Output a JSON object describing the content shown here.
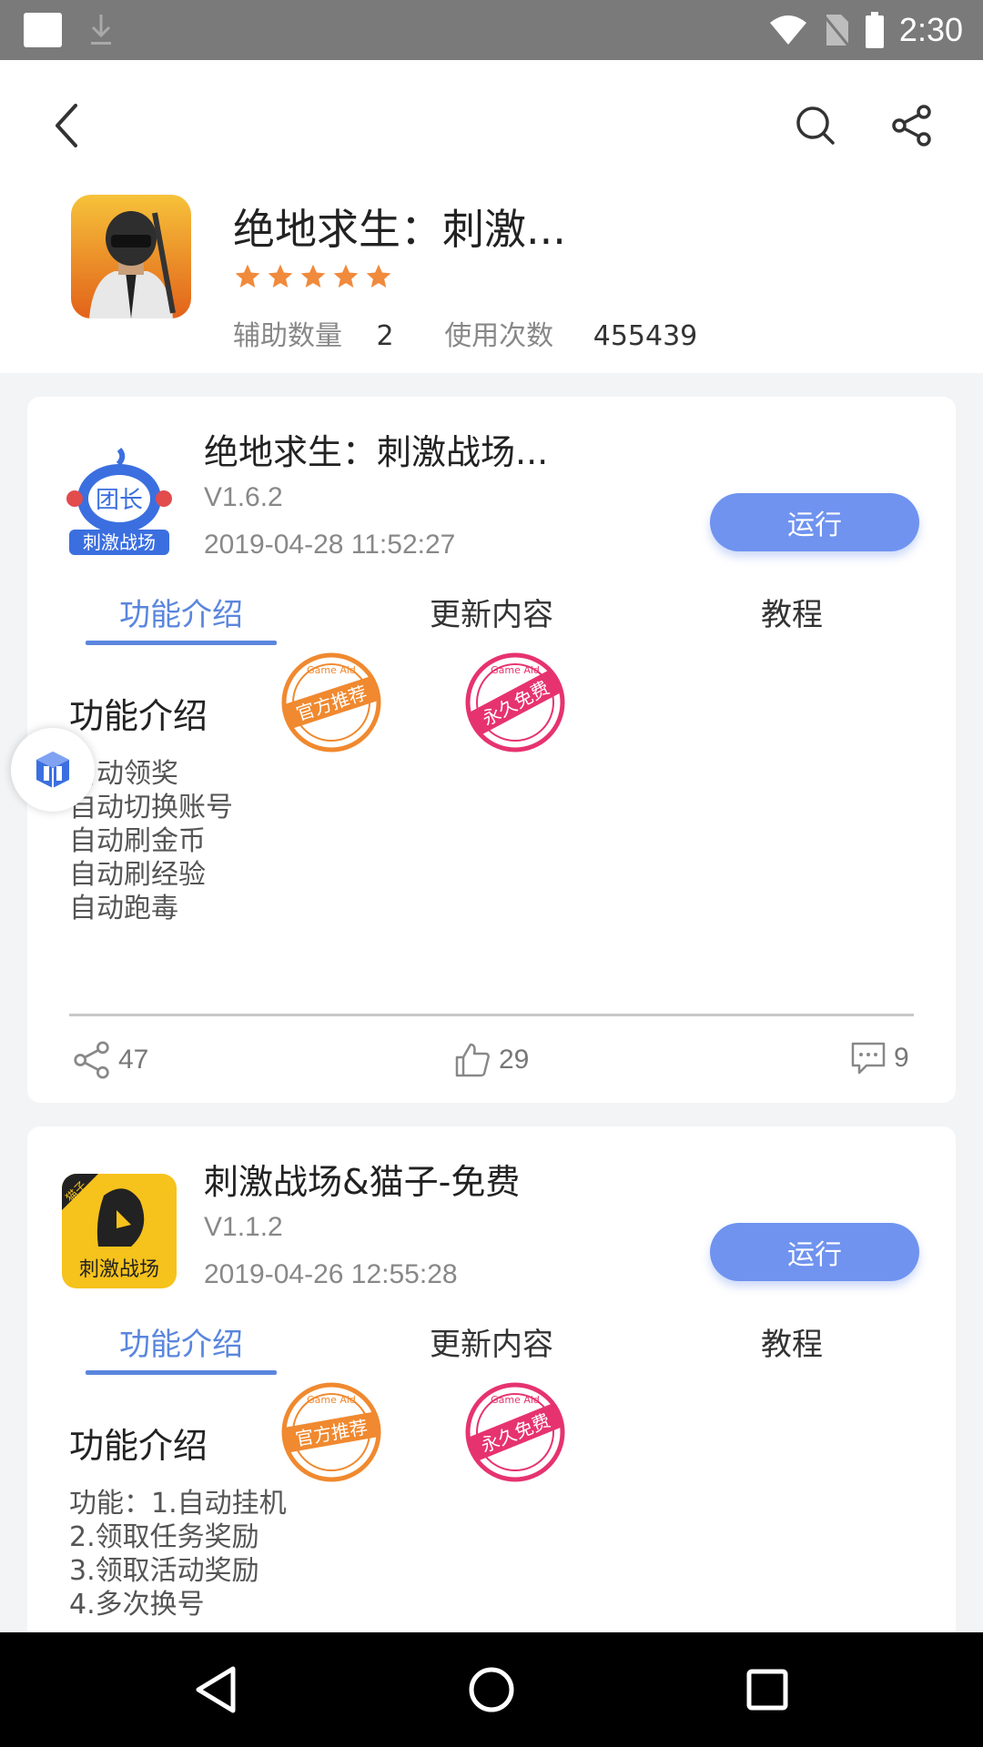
{
  "status_bar": {
    "time": "2:30"
  },
  "header": {
    "title": "绝地求生：刺激...",
    "rating_stars": 5,
    "assist_label": "辅助数量",
    "assist_count": "2",
    "usage_label": "使用次数",
    "usage_count": "455439"
  },
  "cards": [
    {
      "name": "绝地求生：刺激战场...",
      "version": "V1.6.2",
      "date": "2019-04-28 11:52:27",
      "run_label": "运行",
      "icon_text_top": "团长",
      "icon_text_bottom": "刺激战场",
      "tabs": [
        "功能介绍",
        "更新内容",
        "教程"
      ],
      "section_title": "功能介绍",
      "stamp_official": "官方推荐",
      "stamp_free": "永久免费",
      "stamp_ring": "Game Aid",
      "features": [
        "自动领奖",
        "自动切换账号",
        "自动刷金币",
        "自动刷经验",
        "自动跑毒"
      ],
      "shares": "47",
      "likes": "29",
      "comments": "9"
    },
    {
      "name": "刺激战场&猫子-免费",
      "version": "V1.1.2",
      "date": "2019-04-26 12:55:28",
      "run_label": "运行",
      "icon_text_top": "猫子",
      "icon_text_bottom": "刺激战场",
      "tabs": [
        "功能介绍",
        "更新内容",
        "教程"
      ],
      "section_title": "功能介绍",
      "stamp_official": "官方推荐",
      "stamp_free": "永久免费",
      "stamp_ring": "Game Aid",
      "features": [
        "功能：1.自动挂机",
        "2.领取任务奖励",
        "3.领取活动奖励",
        "4.多次换号"
      ]
    }
  ],
  "colors": {
    "accent": "#5a86dd",
    "run_button": "#6f93ef",
    "star": "#f08a3c",
    "stamp_orange": "#f0892f",
    "stamp_pink": "#e6336f"
  },
  "icons": {
    "back": "chevron-left-icon",
    "search": "search-icon",
    "share": "share-icon",
    "like": "thumbs-up-icon",
    "comment": "comment-icon",
    "float": "cube-icon"
  }
}
